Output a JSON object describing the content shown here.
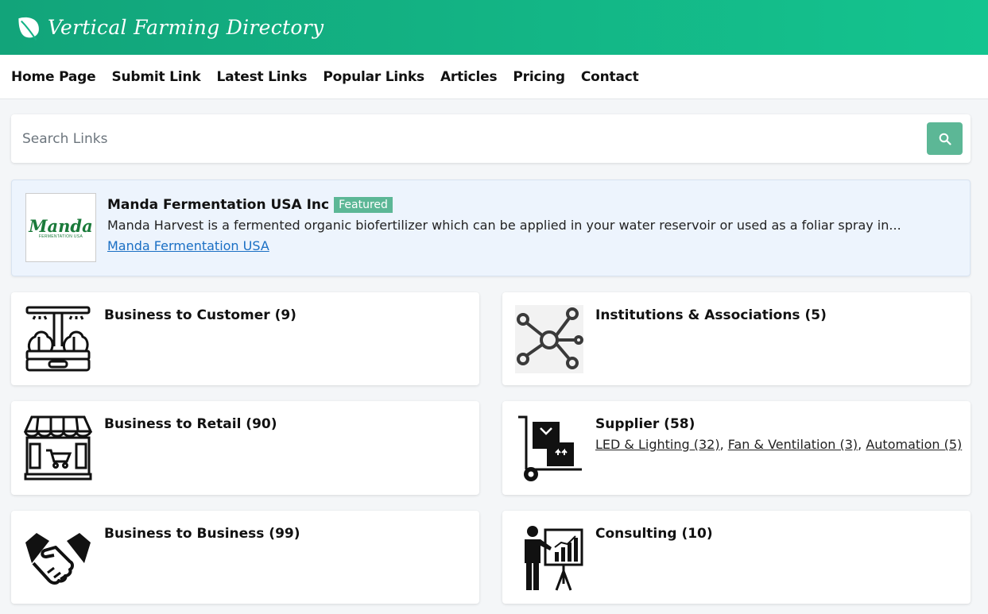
{
  "header": {
    "brand": "Vertical Farming Directory"
  },
  "nav": [
    "Home Page",
    "Submit Link",
    "Latest Links",
    "Popular Links",
    "Articles",
    "Pricing",
    "Contact"
  ],
  "search": {
    "placeholder": "Search Links",
    "value": ""
  },
  "featured": {
    "title": "Manda Fermentation USA Inc",
    "badge": "Featured",
    "description": "Manda Harvest is a fermented organic biofertilizer which can be applied in your water reservoir or used as a foliar spray in...",
    "link": "Manda Fermentation USA",
    "logo_text": "Manda",
    "logo_subtext": "FERMENTATION USA"
  },
  "categories": [
    {
      "title": "Business to Customer (9)",
      "icon": "grow-tower-icon"
    },
    {
      "title": "Institutions & Associations (5)",
      "icon": "network-icon"
    },
    {
      "title": "Business to Retail (90)",
      "icon": "storefront-icon"
    },
    {
      "title": "Supplier (58)",
      "icon": "hand-truck-icon",
      "subs": [
        {
          "label": "LED & Lighting (32)",
          "sep": ", "
        },
        {
          "label": "Fan & Ventilation (3)",
          "sep": ", "
        },
        {
          "label": "Automation (5)",
          "sep": ""
        }
      ]
    },
    {
      "title": "Business to Business (99)",
      "icon": "handshake-icon"
    },
    {
      "title": "Consulting (10)",
      "icon": "presentation-icon"
    }
  ]
}
